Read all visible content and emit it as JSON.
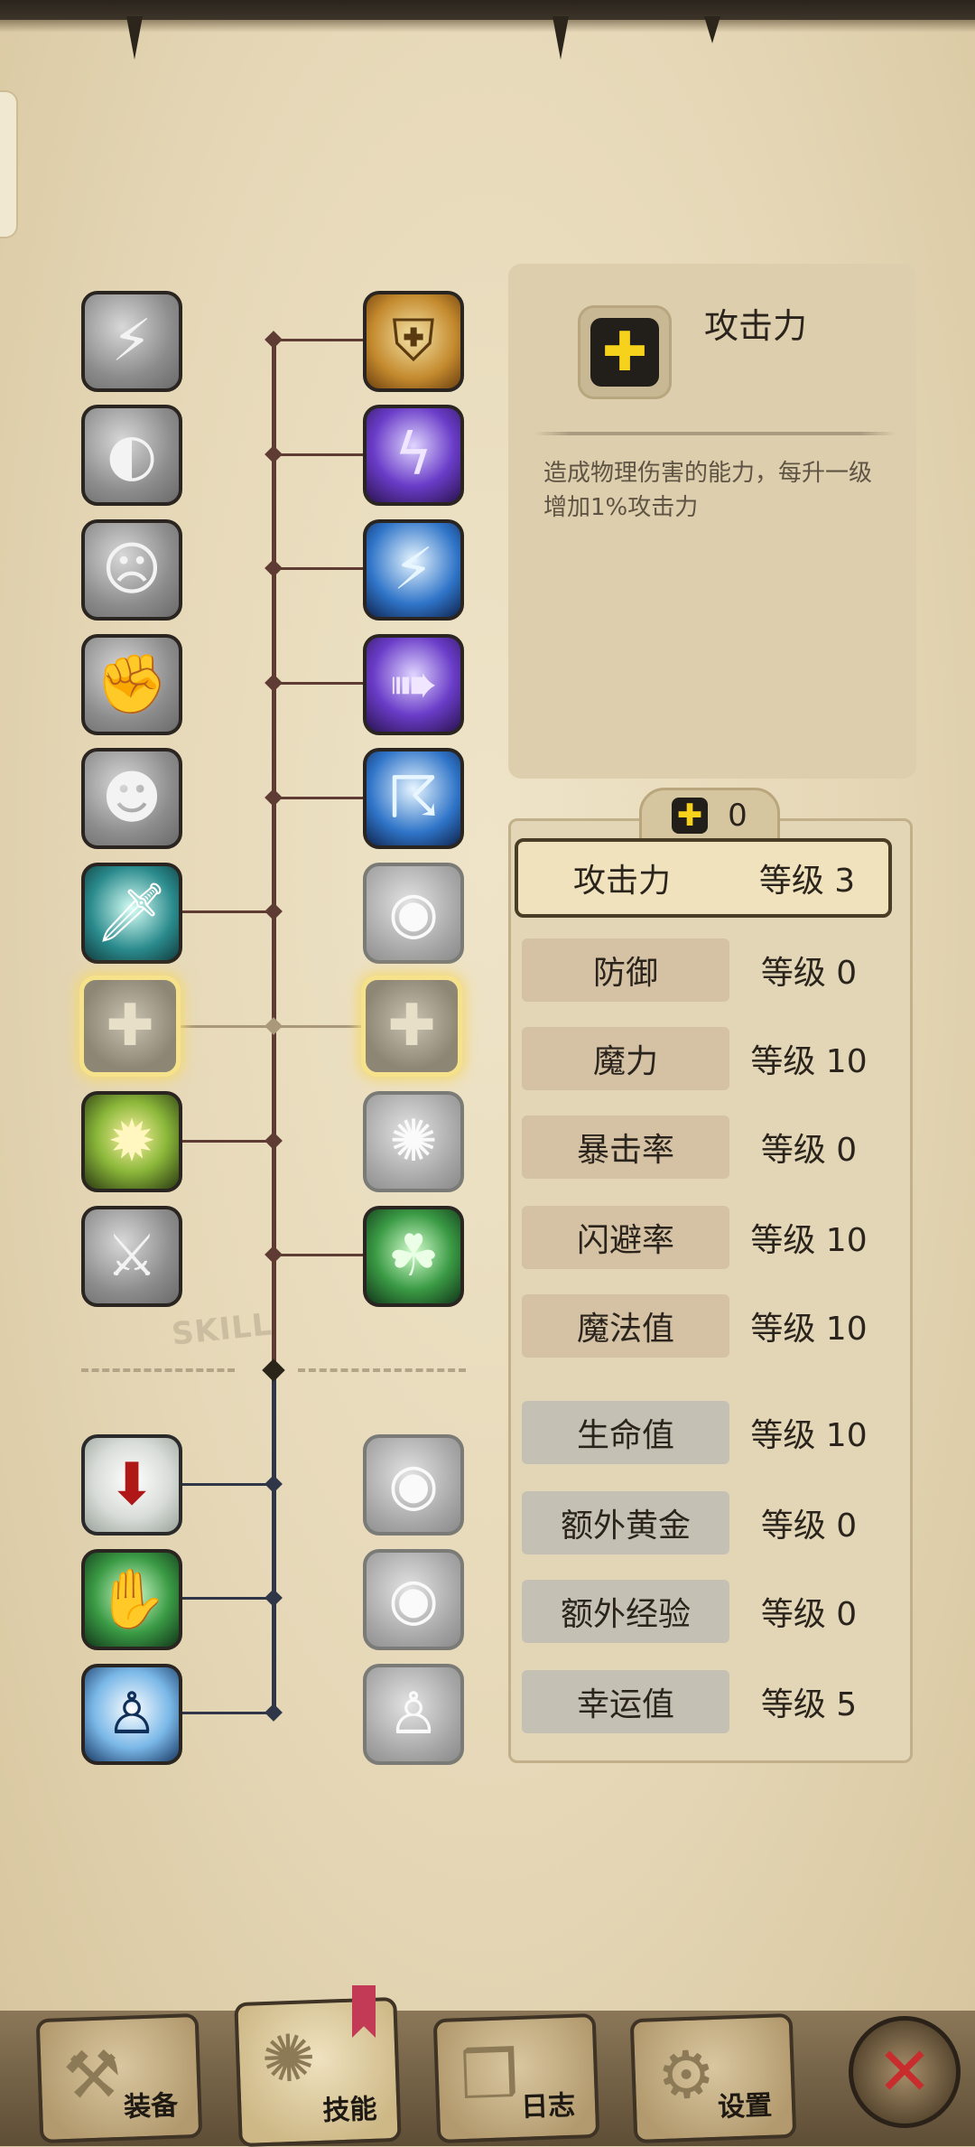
{
  "info": {
    "title": "攻击力",
    "description": "造成物理伤害的能力，每升一级增加1%攻击力"
  },
  "points": {
    "value": "0"
  },
  "stats": [
    {
      "name": "攻击力",
      "level": "等级 3"
    },
    {
      "name": "防御",
      "level": "等级 0"
    },
    {
      "name": "魔力",
      "level": "等级 10"
    },
    {
      "name": "暴击率",
      "level": "等级 0"
    },
    {
      "name": "闪避率",
      "level": "等级 10"
    },
    {
      "name": "魔法值",
      "level": "等级 10"
    },
    {
      "name": "生命值",
      "level": "等级 10"
    },
    {
      "name": "额外黄金",
      "level": "等级 0"
    },
    {
      "name": "额外经验",
      "level": "等级 0"
    },
    {
      "name": "幸运值",
      "level": "等级 5"
    }
  ],
  "skill_tree": {
    "divider_label": "SKILL"
  },
  "nav": [
    {
      "label": "装备",
      "icon": "sword-axe-icon"
    },
    {
      "label": "技能",
      "icon": "skill-circle-icon"
    },
    {
      "label": "日志",
      "icon": "journal-icon"
    },
    {
      "label": "设置",
      "icon": "gear-icon"
    }
  ],
  "close": {
    "icon": "close-x-icon"
  },
  "colors": {
    "accent_plus": "#f6d21c",
    "close_red": "#c82c2c",
    "bookmark": "#c23a55"
  }
}
